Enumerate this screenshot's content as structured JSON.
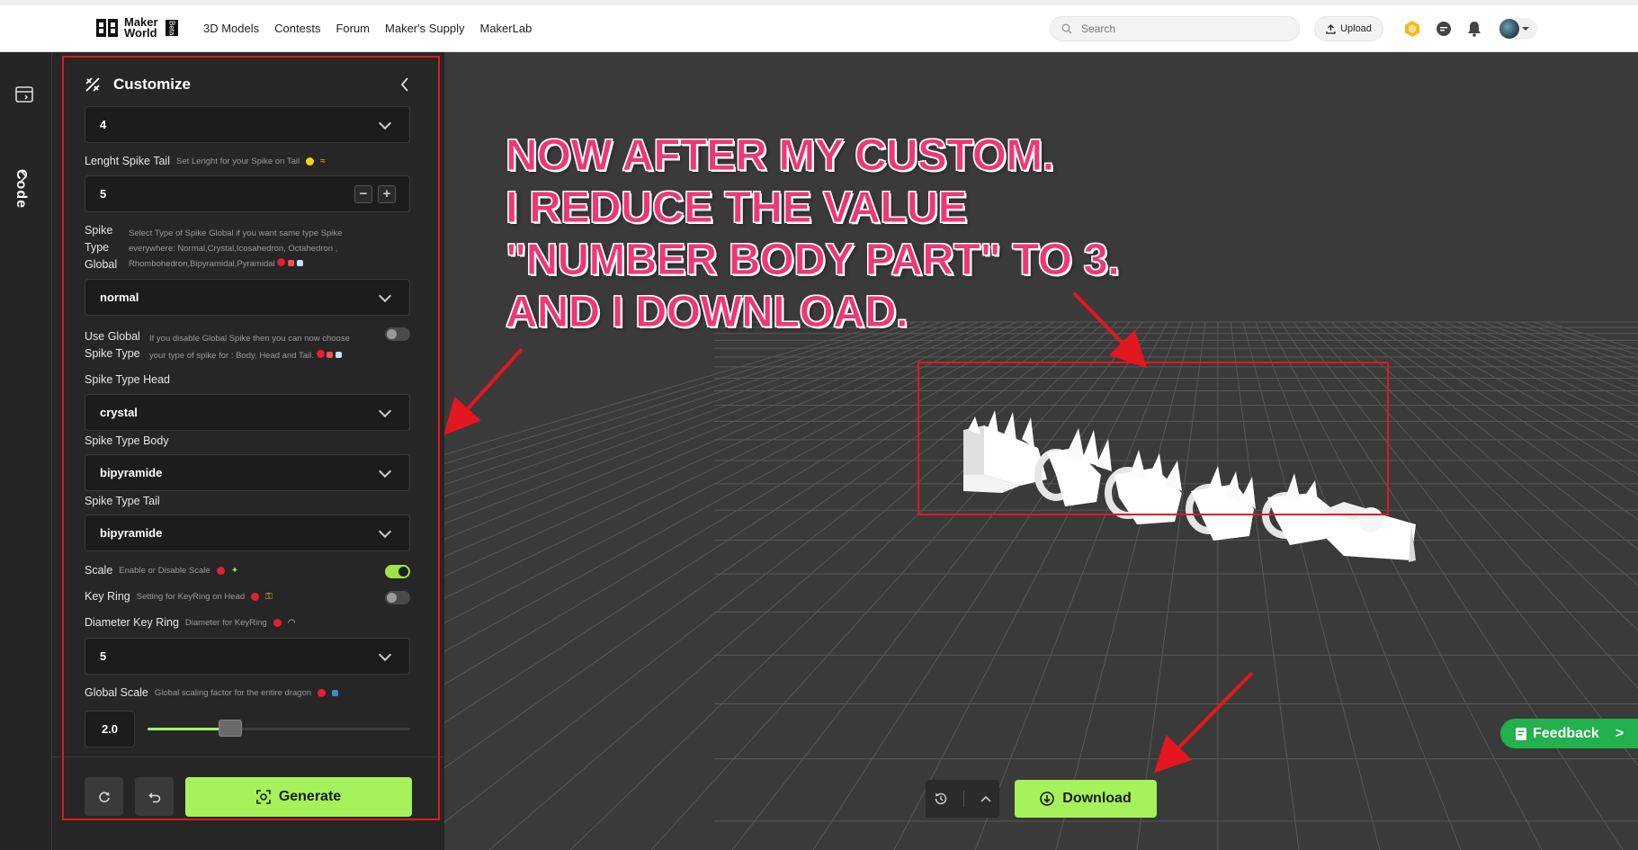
{
  "brand": {
    "line1": "Maker",
    "line2": "World",
    "badge": "Beta"
  },
  "nav": [
    "3D Models",
    "Contests",
    "Forum",
    "Maker's Supply",
    "MakerLab"
  ],
  "search": {
    "placeholder": "Search"
  },
  "upload_label": "Upload",
  "rail": {
    "code_label": "Code"
  },
  "panel": {
    "title": "Customize",
    "top_select_value": "4",
    "lenght_tail": {
      "label": "Lenght Spike Tail",
      "desc": "Set Lenght for your Spike on Tail",
      "value": "5"
    },
    "spike_type_global": {
      "label_1": "Spike",
      "label_2": "Type",
      "label_3": "Global",
      "desc_1": "Select Type of Spike Global if you want same type Spike",
      "desc_2": "everywhere: Normal,Crystal,Icosahedron, Octahedron ,",
      "desc_3": "Rhombohedron,Bipyramidal,Pyramidal",
      "value": "normal"
    },
    "use_global": {
      "label_1": "Use Global",
      "label_2": "Spike Type",
      "desc_1": "If you disable Global Spike then you can now choose",
      "desc_2": "your type of spike for : Body, Head and Tail.",
      "enabled": false
    },
    "head": {
      "label": "Spike Type Head",
      "value": "crystal"
    },
    "body": {
      "label": "Spike Type Body",
      "value": "bipyramide"
    },
    "tail": {
      "label": "Spike Type Tail",
      "value": "bipyramide"
    },
    "scale": {
      "label": "Scale",
      "desc": "Enable or Disable Scale",
      "enabled": true
    },
    "key_ring": {
      "label": "Key Ring",
      "desc": "Setting for KeyRing on Head",
      "enabled": false
    },
    "diameter": {
      "label": "Diameter Key Ring",
      "desc": "Diameter for KeyRing",
      "value": "5"
    },
    "global_scale": {
      "label": "Global Scale",
      "desc": "Global scaling factor for the entire dragon",
      "value": "2.0",
      "slider_fraction": 0.29
    },
    "generate_label": "Generate"
  },
  "viewport": {
    "annotation_lines": [
      "NOW AFTER MY CUSTOM.",
      "I REDUCE THE VALUE",
      "\"NUMBER BODY PART\" TO 3.",
      "AND I DOWNLOAD."
    ],
    "download_label": "Download",
    "feedback_label": "Feedback",
    "feedback_arrow": ">"
  },
  "colors": {
    "accent": "#a6f25a",
    "annotation": "#ee3775",
    "highlight": "#e3171f",
    "feedback": "#22b14c"
  }
}
